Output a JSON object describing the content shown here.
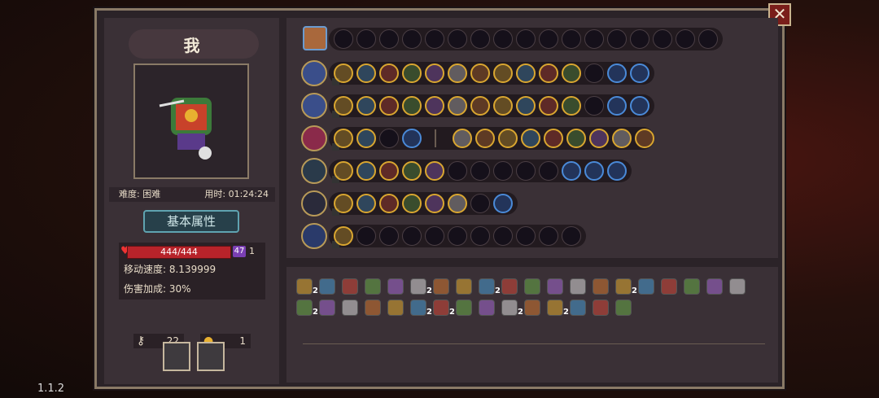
{
  "version": "1.1.2",
  "close_label": "✕",
  "player": {
    "name": "我",
    "difficulty": "难度: 困难",
    "time": "用时: 01:24:24"
  },
  "tab_label": "基本属性",
  "stats": {
    "hp": "444/444",
    "hp_fraction": 1.0,
    "shield": "47",
    "shield_extra": "1",
    "move_speed": "移动速度: 8.139999",
    "damage_bonus": "伤害加成: 30%"
  },
  "resources": {
    "keys": "22",
    "coins": "1"
  },
  "colors": {
    "accent": "#d9a630",
    "frame": "#8a7a66",
    "hp": "#b8232a",
    "tab": "#5fa3b0"
  },
  "item_counts": [
    "2",
    "2",
    "2",
    "2",
    "2",
    "2",
    "2",
    "2",
    "2",
    "2",
    "2",
    "2",
    "4"
  ]
}
